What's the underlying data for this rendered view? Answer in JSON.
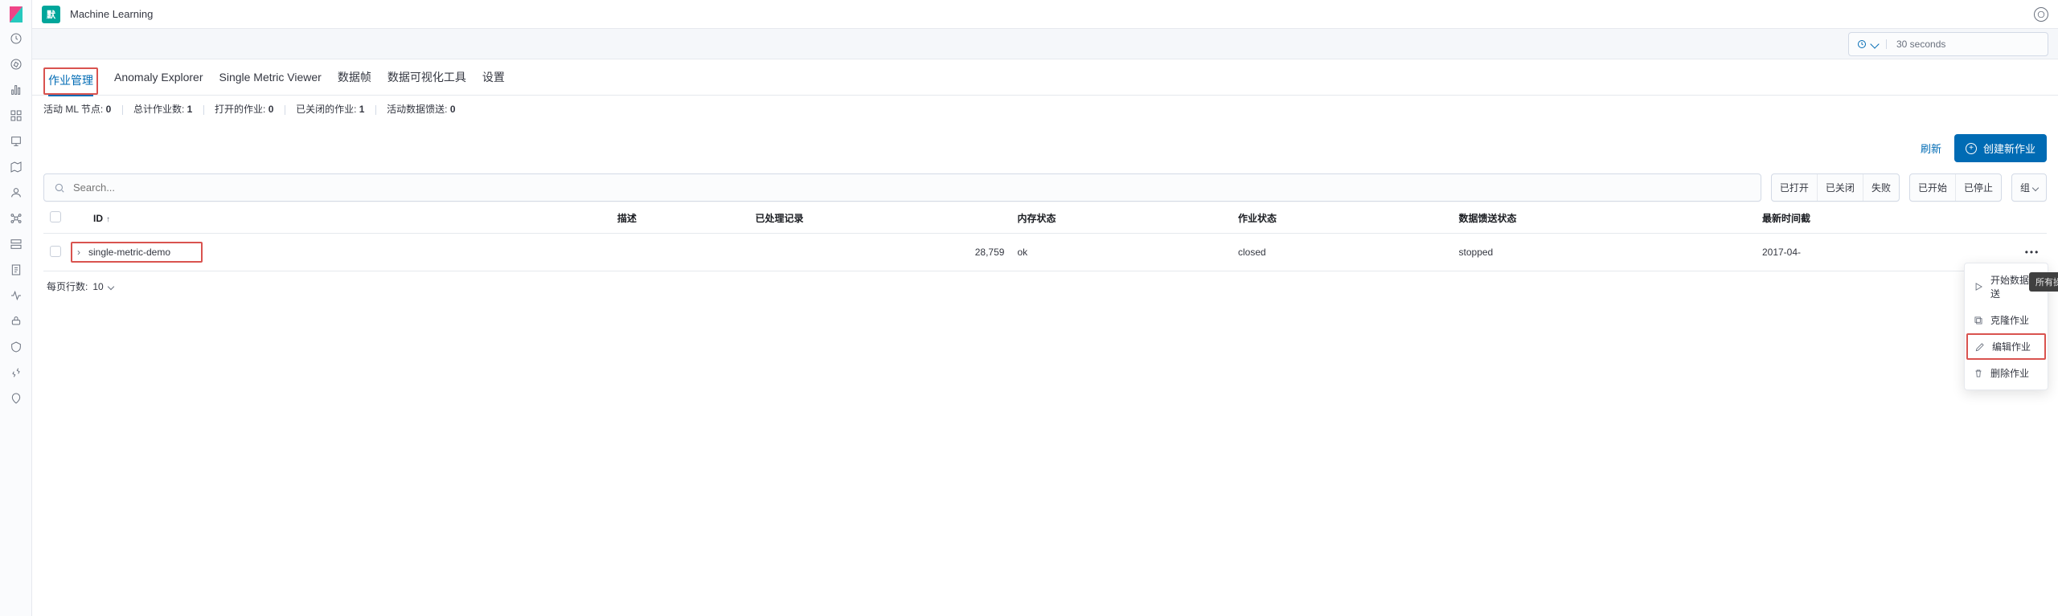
{
  "header": {
    "badge": "默",
    "app_title": "Machine Learning"
  },
  "refresh": {
    "interval_label": "30 seconds"
  },
  "tabs": {
    "items": [
      {
        "label": "作业管理",
        "active": true
      },
      {
        "label": "Anomaly Explorer"
      },
      {
        "label": "Single Metric Viewer"
      },
      {
        "label": "数据帧"
      },
      {
        "label": "数据可视化工具"
      },
      {
        "label": "设置"
      }
    ]
  },
  "stats": {
    "ml_nodes_label": "活动 ML 节点:",
    "ml_nodes_value": "0",
    "total_jobs_label": "总计作业数:",
    "total_jobs_value": "1",
    "open_jobs_label": "打开的作业:",
    "open_jobs_value": "0",
    "closed_jobs_label": "已关闭的作业:",
    "closed_jobs_value": "1",
    "datafeed_label": "活动数据馈送:",
    "datafeed_value": "0"
  },
  "actions": {
    "refresh_label": "刷新",
    "create_label": "创建新作业"
  },
  "search": {
    "placeholder": "Search..."
  },
  "filters": {
    "opened": "已打开",
    "closed": "已关闭",
    "failed": "失败",
    "started": "已开始",
    "stopped": "已停止",
    "group": "组"
  },
  "table": {
    "headers": {
      "id": "ID",
      "desc": "描述",
      "processed": "已处理记录",
      "mem": "内存状态",
      "job_state": "作业状态",
      "datafeed_state": "数据馈送状态",
      "latest_ts": "最新时间截"
    },
    "rows": [
      {
        "id": "single-metric-demo",
        "desc": "",
        "processed": "28,759",
        "mem": "ok",
        "job_state": "closed",
        "datafeed_state": "stopped",
        "latest_ts": "2017-04-"
      }
    ],
    "footer": {
      "rows_per_page_label": "每页行数:",
      "rows_per_page_value": "10"
    }
  },
  "context_menu": {
    "start_datafeed": "开始数据馈送",
    "clone_job": "克隆作业",
    "edit_job": "编辑作业",
    "delete_job": "删除作业"
  },
  "tooltip": {
    "text": "所有操作"
  }
}
